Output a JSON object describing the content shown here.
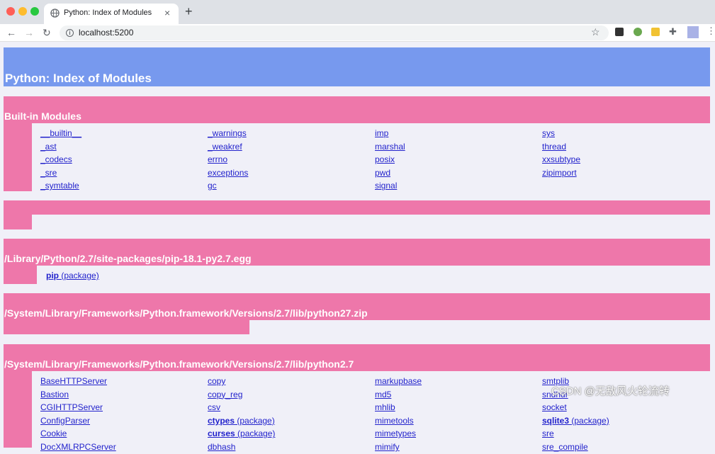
{
  "browser": {
    "tab_title": "Python: Index of Modules",
    "tab_close": "×",
    "new_tab": "+",
    "url": "localhost:5200",
    "icons": {
      "back": "arrow-left-icon",
      "forward": "arrow-right-icon",
      "reload": "reload-icon",
      "info": "info-icon",
      "bookmark": "star-icon",
      "extensions": "puzzle-icon",
      "menu": "kebab-menu-icon"
    }
  },
  "page": {
    "title": "Python: Index of Modules",
    "colors": {
      "heading": "#7799ee",
      "section": "#ee77aa",
      "link": "#2222cc",
      "background": "#f0f0f8"
    },
    "sections": [
      {
        "title": "Built-in Modules",
        "columns": [
          [
            "__builtin__",
            "_ast",
            "_codecs",
            "_sre",
            "_symtable"
          ],
          [
            "_warnings",
            "_weakref",
            "errno",
            "exceptions",
            "gc"
          ],
          [
            "imp",
            "marshal",
            "posix",
            "pwd",
            "signal"
          ],
          [
            "sys",
            "thread",
            "xxsubtype",
            "zipimport"
          ]
        ]
      },
      {
        "title": ""
      },
      {
        "title": "/Library/Python/2.7/site-packages/pip-18.1-py2.7.egg",
        "packages": [
          {
            "name": "pip",
            "suffix": " (package)"
          }
        ]
      },
      {
        "title": "/System/Library/Frameworks/Python.framework/Versions/2.7/lib/python27.zip"
      },
      {
        "title": "/System/Library/Frameworks/Python.framework/Versions/2.7/lib/python2.7",
        "columns": [
          [
            {
              "name": "BaseHTTPServer"
            },
            {
              "name": "Bastion"
            },
            {
              "name": "CGIHTTPServer"
            },
            {
              "name": "ConfigParser"
            },
            {
              "name": "Cookie"
            },
            {
              "name": "DocXMLRPCServer"
            }
          ],
          [
            {
              "name": "copy"
            },
            {
              "name": "copy_reg"
            },
            {
              "name": "csv"
            },
            {
              "name": "ctypes",
              "suffix": " (package)"
            },
            {
              "name": "curses",
              "suffix": " (package)"
            },
            {
              "name": "dbhash"
            }
          ],
          [
            {
              "name": "markupbase"
            },
            {
              "name": "md5"
            },
            {
              "name": "mhlib"
            },
            {
              "name": "mimetools"
            },
            {
              "name": "mimetypes"
            },
            {
              "name": "mimify"
            }
          ],
          [
            {
              "name": "smtplib"
            },
            {
              "name": "sndhdr"
            },
            {
              "name": "socket"
            },
            {
              "name": "sqlite3",
              "suffix": " (package)"
            },
            {
              "name": "sre"
            },
            {
              "name": "sre_compile"
            }
          ]
        ]
      }
    ]
  },
  "watermark": "CSDN @无敌风火轮流转"
}
